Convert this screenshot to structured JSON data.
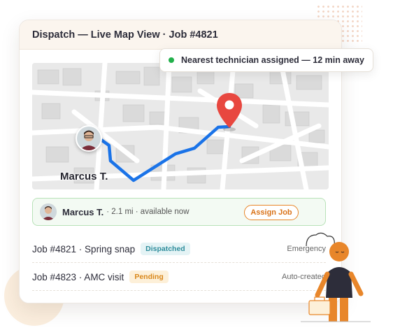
{
  "card": {
    "title": "Dispatch — Live Map View · Job #4821"
  },
  "toast": {
    "text": "Nearest technician assigned — 12 min away",
    "status_color": "#22b04b"
  },
  "map": {
    "technician_label": "Marcus T.",
    "route_color": "#1a73e8",
    "pin_color": "#e8473f"
  },
  "technician_row": {
    "name": "Marcus T.",
    "meta": "· 2.1 mi · available now",
    "action_label": "Assign Job"
  },
  "jobs": [
    {
      "title": "Job #4821 · Spring snap",
      "badge": "Dispatched",
      "tag": "Emergency"
    },
    {
      "title": "Job #4823 · AMC visit",
      "badge": "Pending",
      "tag": "Auto-created"
    }
  ],
  "colors": {
    "accent": "#e8862a",
    "success": "#22b04b"
  }
}
